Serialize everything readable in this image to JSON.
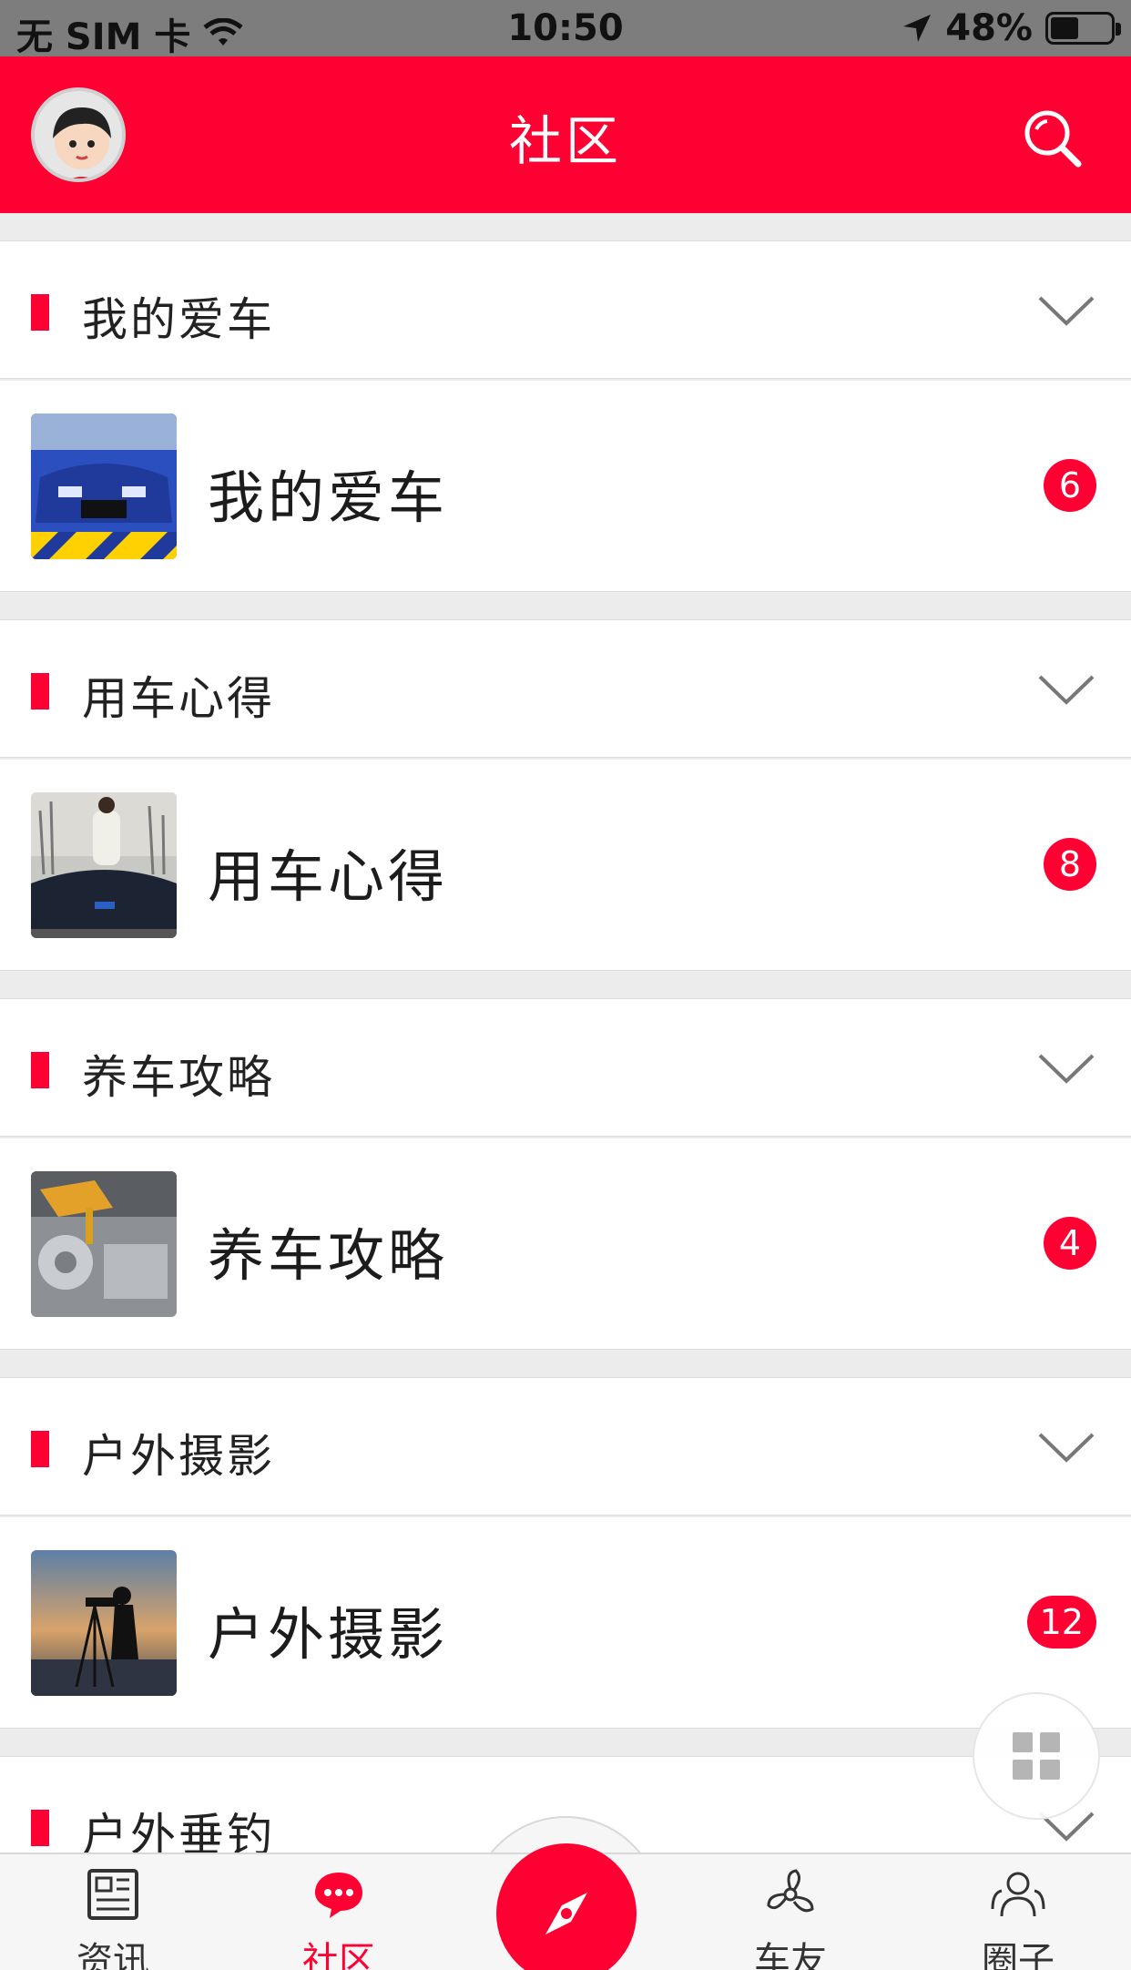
{
  "status_bar": {
    "carrier": "无 SIM 卡",
    "time": "10:50",
    "battery": "48%",
    "battery_level": 0.48
  },
  "header": {
    "title": "社区"
  },
  "sections": [
    {
      "title": "我的爱车",
      "forum_name": "我的爱车",
      "count": "6"
    },
    {
      "title": "用车心得",
      "forum_name": "用车心得",
      "count": "8"
    },
    {
      "title": "养车攻略",
      "forum_name": "养车攻略",
      "count": "4"
    },
    {
      "title": "户外摄影",
      "forum_name": "户外摄影",
      "count": "12"
    },
    {
      "title": "户外垂钓"
    }
  ],
  "tabbar": {
    "items": [
      {
        "label": "资讯",
        "icon": "newspaper-icon"
      },
      {
        "label": "社区",
        "icon": "chat-bubble-icon"
      },
      {
        "label": "车友",
        "icon": "fan-icon"
      },
      {
        "label": "圈子",
        "icon": "people-icon"
      }
    ],
    "center_icon": "compass-icon",
    "active_index": 1
  },
  "colors": {
    "brand": "#ff0033",
    "background": "#ececec"
  }
}
